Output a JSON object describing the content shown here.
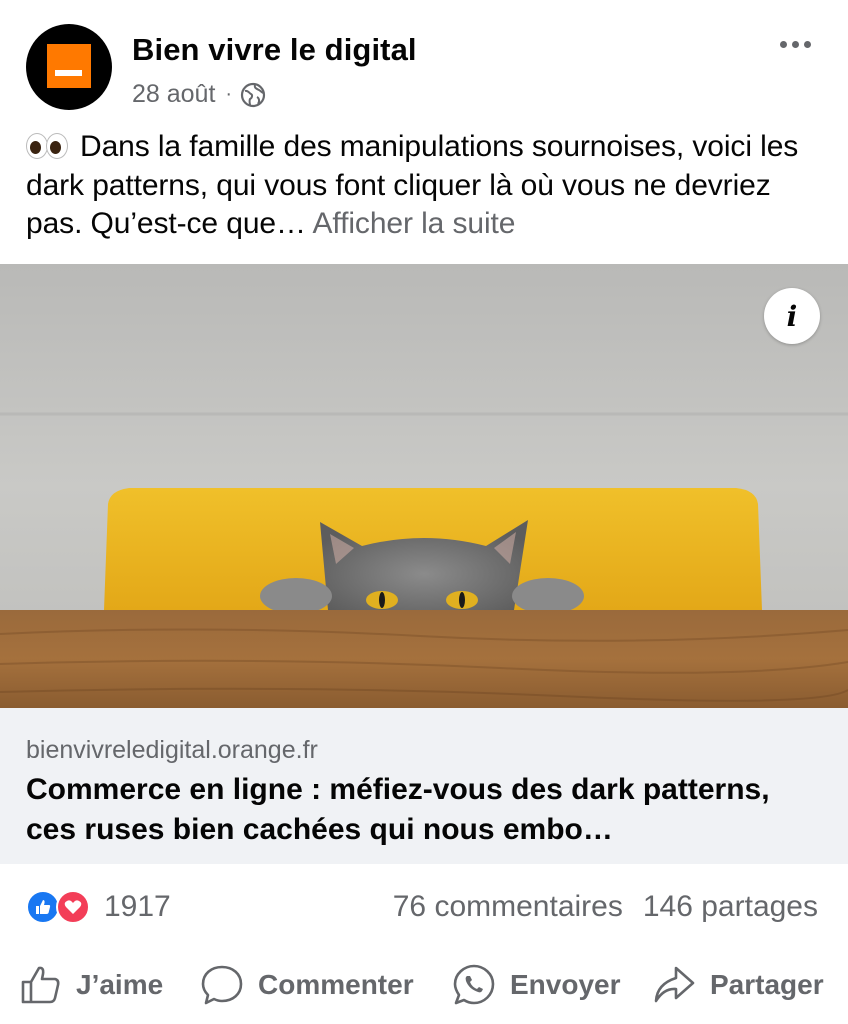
{
  "post": {
    "page_name": "Bien vivre le digital",
    "date": "28 août",
    "separator": "·",
    "privacy_icon": "globe-icon",
    "more_icon": "more-options-icon",
    "text": "Dans la famille des manipulations sournoises, voici les dark patterns, qui vous font cliquer là où vous ne devriez pas. Qu’est-ce que…",
    "see_more": "Afficher la suite",
    "emoji": "👀"
  },
  "link_preview": {
    "image_desc_icon": "info-icon",
    "info_label": "i",
    "domain": "bienvivreledigital.orange.fr",
    "title": "Commerce en ligne : méfiez-vous des dark patterns, ces ruses bien cachées qui nous embo…"
  },
  "stats": {
    "reaction_count": "1917",
    "comments": "76 commentaires",
    "shares": "146 partages"
  },
  "actions": {
    "like": "J’aime",
    "comment": "Commenter",
    "send": "Envoyer",
    "share": "Partager"
  },
  "colors": {
    "brand_orange": "#ff7900",
    "like_blue": "#1877f2",
    "love_red": "#f33e58",
    "secondary_text": "#65676b",
    "preview_bg": "#f0f2f5"
  }
}
